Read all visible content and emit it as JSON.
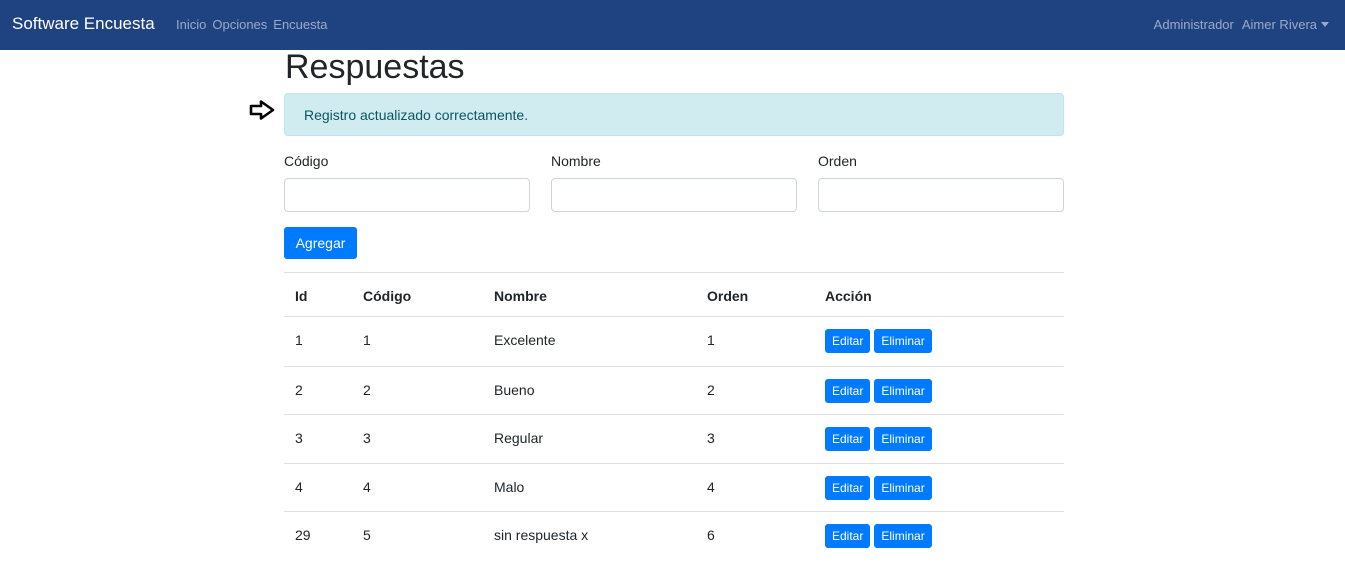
{
  "navbar": {
    "brand": "Software Encuesta",
    "links": [
      "Inicio",
      "Opciones",
      "Encuesta"
    ],
    "admin": "Administrador",
    "user": "Aimer Rivera"
  },
  "page": {
    "title": "Respuestas"
  },
  "alert": {
    "message": "Registro actualizado correctamente."
  },
  "form": {
    "codigo_label": "Código",
    "codigo_value": "",
    "nombre_label": "Nombre",
    "nombre_value": "",
    "orden_label": "Orden",
    "orden_value": "",
    "add_label": "Agregar"
  },
  "table": {
    "headers": [
      "Id",
      "Código",
      "Nombre",
      "Orden",
      "Acción"
    ],
    "rows": [
      {
        "id": "1",
        "codigo": "1",
        "nombre": "Excelente",
        "orden": "1"
      },
      {
        "id": "2",
        "codigo": "2",
        "nombre": "Bueno",
        "orden": "2"
      },
      {
        "id": "3",
        "codigo": "3",
        "nombre": "Regular",
        "orden": "3"
      },
      {
        "id": "4",
        "codigo": "4",
        "nombre": "Malo",
        "orden": "4"
      },
      {
        "id": "29",
        "codigo": "5",
        "nombre": "sin respuesta x",
        "orden": "6"
      }
    ],
    "edit_label": "Editar",
    "delete_label": "Eliminar"
  },
  "colors": {
    "navbar": "#1f4280",
    "primary": "#007bff",
    "alert_bg": "#d1ecf1",
    "alert_text": "#0c5460"
  },
  "icons": {
    "pointer": "arrow-right-outline-icon",
    "dropdown": "caret-down-icon"
  }
}
